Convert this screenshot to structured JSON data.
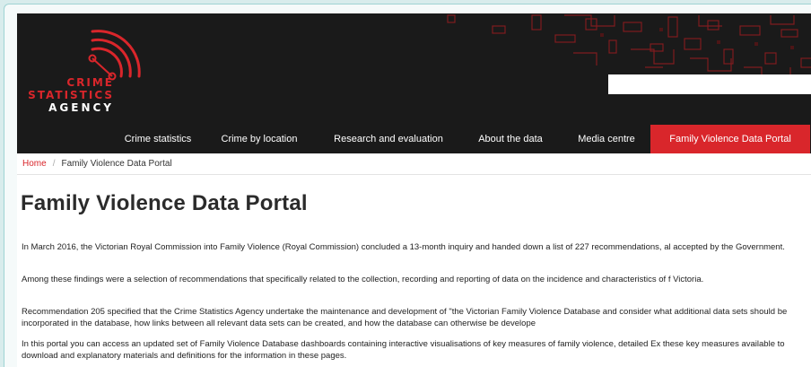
{
  "logo": {
    "line1": "CRIME",
    "line2": "STATISTICS",
    "line3": "AGENCY"
  },
  "search": {
    "value": "",
    "placeholder": ""
  },
  "nav": {
    "items": [
      "Crime statistics",
      "Crime by location",
      "Research and evaluation",
      "About the data",
      "Media centre",
      "Family Violence Data Portal"
    ],
    "active": "Family Violence Data Portal"
  },
  "breadcrumb": {
    "home": "Home",
    "separator": "/",
    "current": "Family Violence Data Portal"
  },
  "page": {
    "title": "Family Violence Data Portal",
    "paragraphs": [
      "In March 2016, the Victorian Royal Commission into Family Violence (Royal Commission) concluded a 13-month inquiry and handed down a list of 227 recommendations, al accepted by the Government.",
      "Among these findings were a selection of recommendations that specifically related to the collection, recording and reporting of data on the incidence and characteristics of f Victoria.",
      "Recommendation 205 specified that the Crime Statistics Agency undertake the maintenance and development of \"the Victorian Family Violence Database and consider what additional data sets should be incorporated in the database, how links between all relevant data sets can be created, and how the database can otherwise be develope",
      "In this portal you can access an updated set of Family Violence Database dashboards containing interactive visualisations of key measures of family violence, detailed Ex these key measures available to download and explanatory materials and definitions for the information in these pages."
    ]
  },
  "colors": {
    "brand_red": "#d9262b",
    "header_bg": "#1a1a1a",
    "frame_teal": "#9fd3d3"
  }
}
